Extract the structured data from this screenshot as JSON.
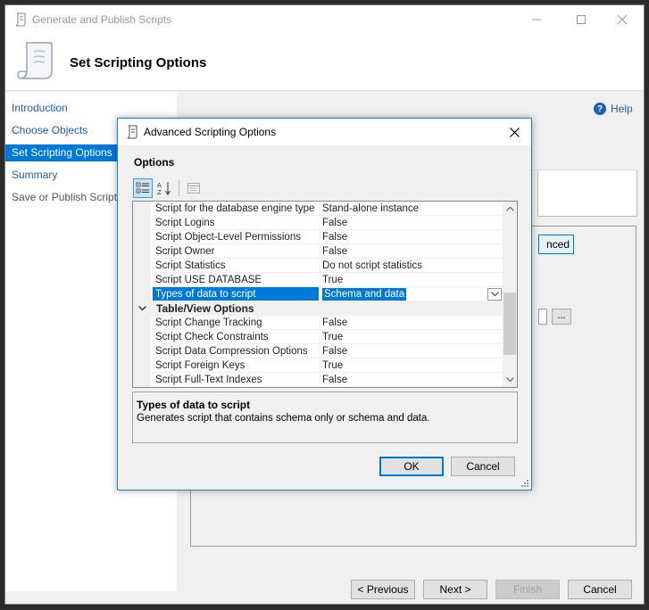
{
  "window": {
    "title": "Generate and Publish Scripts",
    "header_title": "Set Scripting Options"
  },
  "nav": {
    "items": [
      {
        "label": "Introduction",
        "state": "link"
      },
      {
        "label": "Choose Objects",
        "state": "link"
      },
      {
        "label": "Set Scripting Options",
        "state": "selected"
      },
      {
        "label": "Summary",
        "state": "link"
      },
      {
        "label": "Save or Publish Scripts",
        "state": "disabled"
      }
    ]
  },
  "content": {
    "help_label": "Help",
    "advanced_label": "nced",
    "browse_label": "..."
  },
  "footer": {
    "previous": "< Previous",
    "next": "Next >",
    "finish": "Finish",
    "cancel": "Cancel"
  },
  "dialog": {
    "title": "Advanced Scripting Options",
    "heading": "Options",
    "rows": [
      {
        "name": "Script for the database engine type",
        "value": "Stand-alone instance"
      },
      {
        "name": "Script Logins",
        "value": "False"
      },
      {
        "name": "Script Object-Level Permissions",
        "value": "False"
      },
      {
        "name": "Script Owner",
        "value": "False"
      },
      {
        "name": "Script Statistics",
        "value": "Do not script statistics"
      },
      {
        "name": "Script USE DATABASE",
        "value": "True"
      },
      {
        "name": "Types of data to script",
        "value": "Schema and data",
        "selected": true
      }
    ],
    "category": "Table/View Options",
    "table_rows": [
      {
        "name": "Script Change Tracking",
        "value": "False"
      },
      {
        "name": "Script Check Constraints",
        "value": "True"
      },
      {
        "name": "Script Data Compression Options",
        "value": "False"
      },
      {
        "name": "Script Foreign Keys",
        "value": "True"
      },
      {
        "name": "Script Full-Text Indexes",
        "value": "False"
      }
    ],
    "description_title": "Types of data to script",
    "description_text": "Generates script that contains schema only or schema and data.",
    "ok": "OK",
    "cancel": "Cancel"
  },
  "colors": {
    "accent": "#0078d7",
    "link": "#1e5eb5"
  }
}
